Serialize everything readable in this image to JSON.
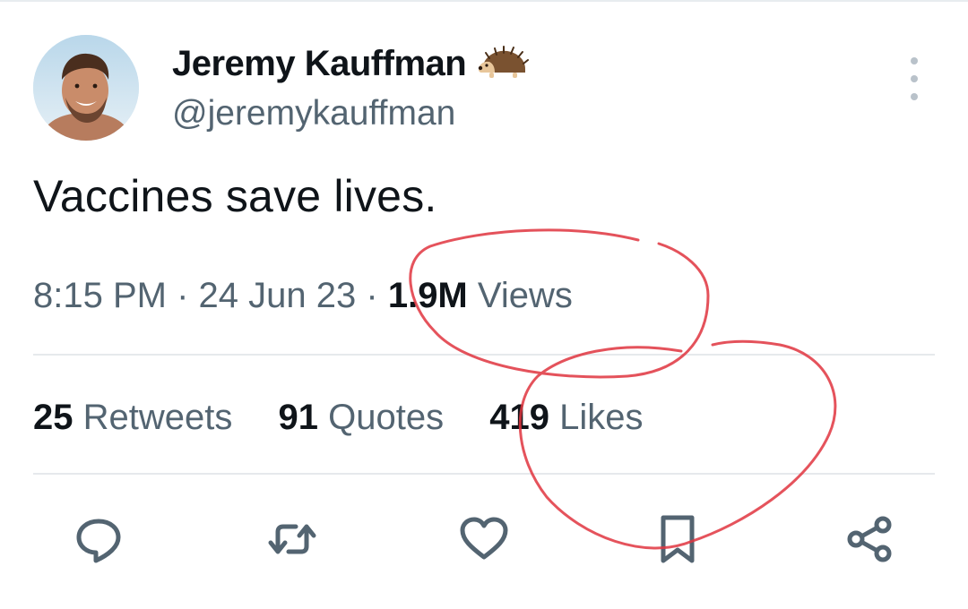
{
  "author": {
    "display_name": "Jeremy Kauffman",
    "name_emoji": "🦔",
    "handle": "@jeremykauffman",
    "avatar_icon": "profile-photo"
  },
  "tweet": {
    "text": "Vaccines save lives.",
    "time": "8:15 PM",
    "separator": "·",
    "date": "24 Jun 23",
    "views_count": "1.9M",
    "views_label": "Views"
  },
  "stats": {
    "retweets_count": "25",
    "retweets_label": "Retweets",
    "quotes_count": "91",
    "quotes_label": "Quotes",
    "likes_count": "419",
    "likes_label": "Likes"
  },
  "actions": [
    {
      "icon": "reply-icon"
    },
    {
      "icon": "retweet-icon"
    },
    {
      "icon": "like-icon"
    },
    {
      "icon": "bookmark-icon"
    },
    {
      "icon": "share-icon"
    }
  ],
  "menu": {
    "icon": "more-options-icon"
  },
  "colors": {
    "text_primary": "#0f1419",
    "text_secondary": "#536471",
    "icon_gray": "#536471",
    "divider": "#e6e9ec",
    "annotation_red": "#e0353f"
  }
}
